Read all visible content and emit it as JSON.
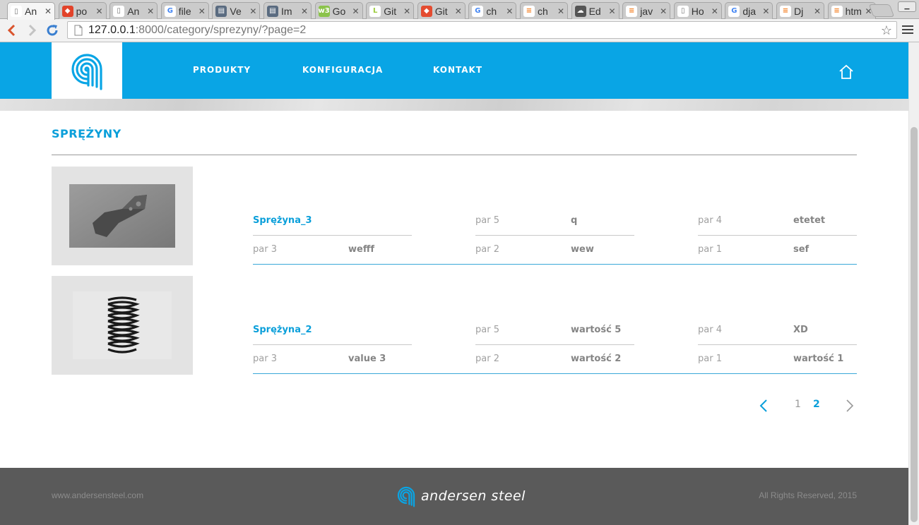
{
  "browser": {
    "tabs": [
      {
        "title": "An",
        "icon": "page-icon",
        "active": true
      },
      {
        "title": "po",
        "icon": "gitlab-icon"
      },
      {
        "title": "An",
        "icon": "page-icon"
      },
      {
        "title": "file",
        "icon": "google-icon"
      },
      {
        "title": "Ve",
        "icon": "doc-icon"
      },
      {
        "title": "Im",
        "icon": "doc-icon"
      },
      {
        "title": "Go",
        "icon": "w3-icon"
      },
      {
        "title": "Git",
        "icon": "gitbook-icon"
      },
      {
        "title": "Git",
        "icon": "git-icon"
      },
      {
        "title": "ch",
        "icon": "google-icon"
      },
      {
        "title": "ch",
        "icon": "stackoverflow-icon"
      },
      {
        "title": "Ed",
        "icon": "cloud-icon"
      },
      {
        "title": "jav",
        "icon": "stackoverflow-icon"
      },
      {
        "title": "Ho",
        "icon": "page-icon"
      },
      {
        "title": "dja",
        "icon": "google-icon"
      },
      {
        "title": "Dj",
        "icon": "stackoverflow-icon"
      },
      {
        "title": "htm",
        "icon": "stackoverflow-icon"
      }
    ],
    "url_host": "127.0.0.1",
    "url_path": ":8000/category/sprezyny/?page=2"
  },
  "site": {
    "nav": [
      "PRODUKTY",
      "KONFIGURACJA",
      "KONTAKT"
    ],
    "category_title": "SPRĘŻYNY",
    "products": [
      {
        "name": "Sprężyna_3",
        "image": "tooth-bracket",
        "params": [
          {
            "label": "par 5",
            "value": "q"
          },
          {
            "label": "par 4",
            "value": "etetet"
          },
          {
            "label": "par 3",
            "value": "wefff"
          },
          {
            "label": "par 2",
            "value": "wew"
          },
          {
            "label": "par 1",
            "value": "sef"
          }
        ]
      },
      {
        "name": "Sprężyna_2",
        "image": "coil-spring",
        "params": [
          {
            "label": "par 5",
            "value": "wartość 5"
          },
          {
            "label": "par 4",
            "value": "XD"
          },
          {
            "label": "par 3",
            "value": "value 3"
          },
          {
            "label": "par 2",
            "value": "wartość 2"
          },
          {
            "label": "par 1",
            "value": "wartość 1"
          }
        ]
      }
    ],
    "pagination": {
      "pages": [
        "1",
        "2"
      ],
      "current": "2"
    },
    "footer": {
      "website": "www.andersensteel.com",
      "brand": "andersen steel",
      "rights": "All Rights Reserved, 2015"
    },
    "colors": {
      "accent": "#09a5e5",
      "footer": "#5a5a5a"
    }
  }
}
